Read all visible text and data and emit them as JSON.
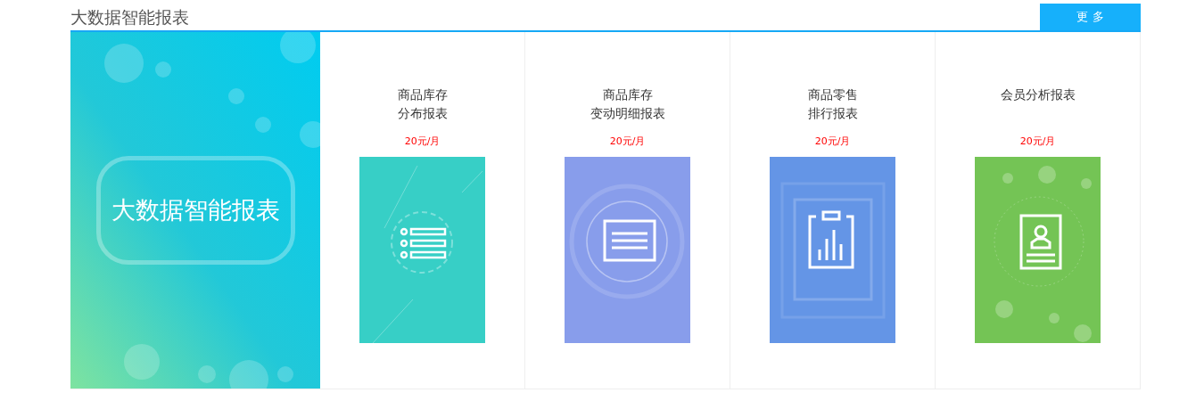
{
  "header": {
    "title": "大数据智能报表",
    "more_button": "更 多"
  },
  "banner": {
    "title": "大数据智能报表"
  },
  "reports": [
    {
      "kind": "list",
      "title_lines": [
        "商品库存",
        "分布报表"
      ],
      "price": "20元/月",
      "color": "#37cfc6"
    },
    {
      "kind": "document",
      "title_lines": [
        "商品库存",
        "变动明细报表"
      ],
      "price": "20元/月",
      "color": "#889deb"
    },
    {
      "kind": "clipboard",
      "title_lines": [
        "商品零售",
        "排行报表"
      ],
      "price": "20元/月",
      "color": "#6495e6"
    },
    {
      "kind": "profile",
      "title_lines": [
        "会员分析报表"
      ],
      "price": "20元/月",
      "color": "#74c455"
    }
  ]
}
